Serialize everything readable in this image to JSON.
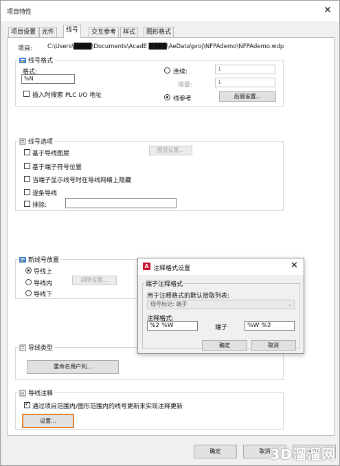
{
  "window": {
    "title": "项目特性",
    "close_glyph": "✕"
  },
  "tabs": [
    {
      "label": "项目设置"
    },
    {
      "label": "元件"
    },
    {
      "label": "线号"
    },
    {
      "label": "交互参考"
    },
    {
      "label": "样式"
    },
    {
      "label": "图形格式"
    }
  ],
  "project": {
    "label": "项目:",
    "path": "C:\\Users\\████\\Documents\\AcadE ████\\AeData\\proj\\NFPAdemo\\NFPAdemo.wdp"
  },
  "wire_format": {
    "title": "线号格式",
    "format_label": "格式:",
    "format_value": "%N",
    "insert_search_label": "插入时搜索 PLC I/O 地址",
    "sequential_label": "连续:",
    "sequential_start": "1",
    "increment_label": "增量:",
    "increment_value": "1",
    "line_ref_label": "线参考",
    "suffix_button": "后缀设置..."
  },
  "wire_options": {
    "title": "线号选项",
    "based_on_layer": "基于导线图层",
    "layer_button": "图层设置...",
    "based_on_terminal": "基于端子符号位置",
    "hide_when_terminal": "当端子显示线号时在导线网络上隐藏",
    "per_wire": "逐条导线",
    "exclude_label": "排除:"
  },
  "placement": {
    "title": "新线号放置",
    "on_wire": "导线上",
    "in_wire": "导线内",
    "gap_button": "间隙设置...",
    "below_wire": "导线下"
  },
  "wire_type": {
    "title": "导线类型",
    "rename_button": "重命名用户列..."
  },
  "annotation": {
    "title": "导线注释",
    "update_label": "通过项目范围内/图形范围内的线号更新来实现注释更新",
    "settings_button": "设置..."
  },
  "footer": {
    "ok": "确定",
    "cancel": "取消",
    "help": "帮助"
  },
  "popup": {
    "app_icon": "A",
    "title": "注释格式设置",
    "close_glyph": "✕",
    "group_title": "端子注释格式",
    "default_list_label": "用于注释格式的默认拾取列表:",
    "combo_value": "线号标记: 端子",
    "format_label": "注释格式:",
    "format_value": "%2 %W",
    "terminal_label": "端子",
    "terminal_value": "%W %2",
    "ok": "确定",
    "cancel": "取消"
  },
  "watermark": "3D溜溜网"
}
